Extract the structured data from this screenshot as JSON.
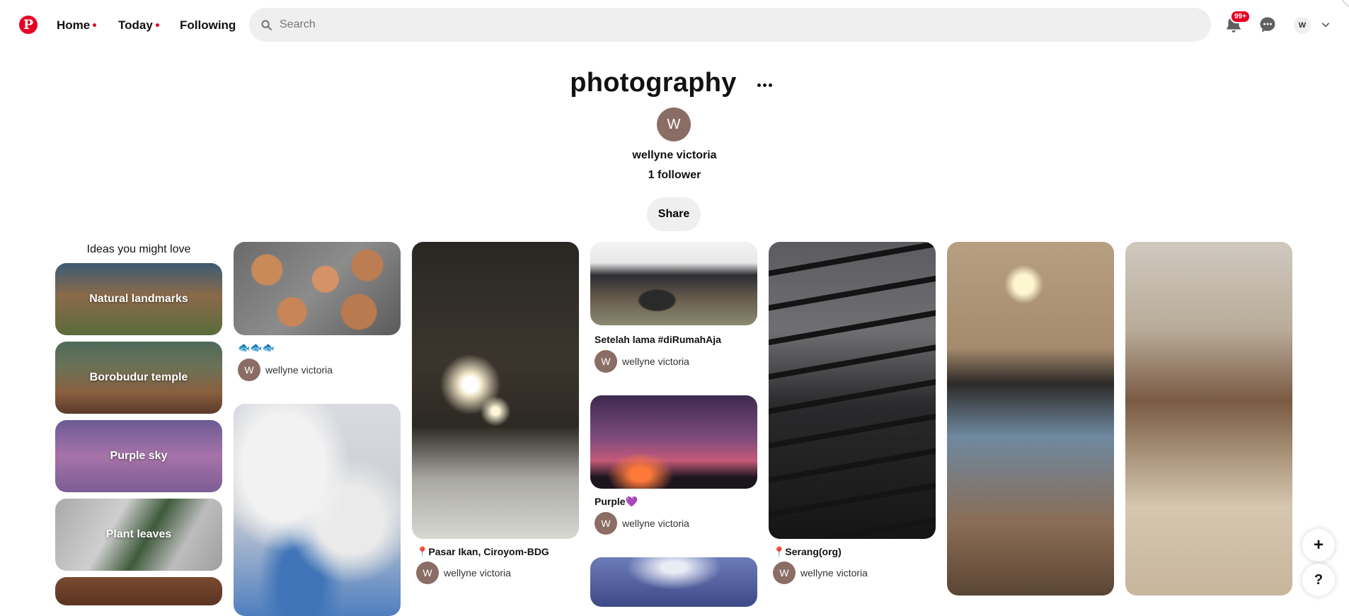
{
  "header": {
    "nav": [
      {
        "label": "Home",
        "dot": true
      },
      {
        "label": "Today",
        "dot": true
      },
      {
        "label": "Following",
        "dot": false
      }
    ],
    "search_placeholder": "Search",
    "notification_badge": "99+",
    "user_initial": "W",
    "accent_color": "#e60023"
  },
  "board": {
    "title": "photography",
    "owner_initial": "W",
    "owner_name": "wellyne victoria",
    "followers": "1 follower",
    "share_label": "Share"
  },
  "ideas": {
    "title": "Ideas you might love",
    "items": [
      "Natural landmarks",
      "Borobudur temple",
      "Purple sky",
      "Plant leaves"
    ]
  },
  "pins": [
    {
      "title": "🐟🐟🐟",
      "user": "wellyne victoria",
      "user_initial": "W"
    },
    {
      "title": "📍Pasar Ikan, Ciroyom-BDG",
      "user": "wellyne victoria",
      "user_initial": "W"
    },
    {
      "title": "Setelah lama #diRumahAja",
      "user": "wellyne victoria",
      "user_initial": "W"
    },
    {
      "title": "Purple💜",
      "user": "wellyne victoria",
      "user_initial": "W"
    },
    {
      "title": "📍Serang(org)",
      "user": "wellyne victoria",
      "user_initial": "W"
    }
  ],
  "fab": {
    "add": "+",
    "help": "?"
  }
}
